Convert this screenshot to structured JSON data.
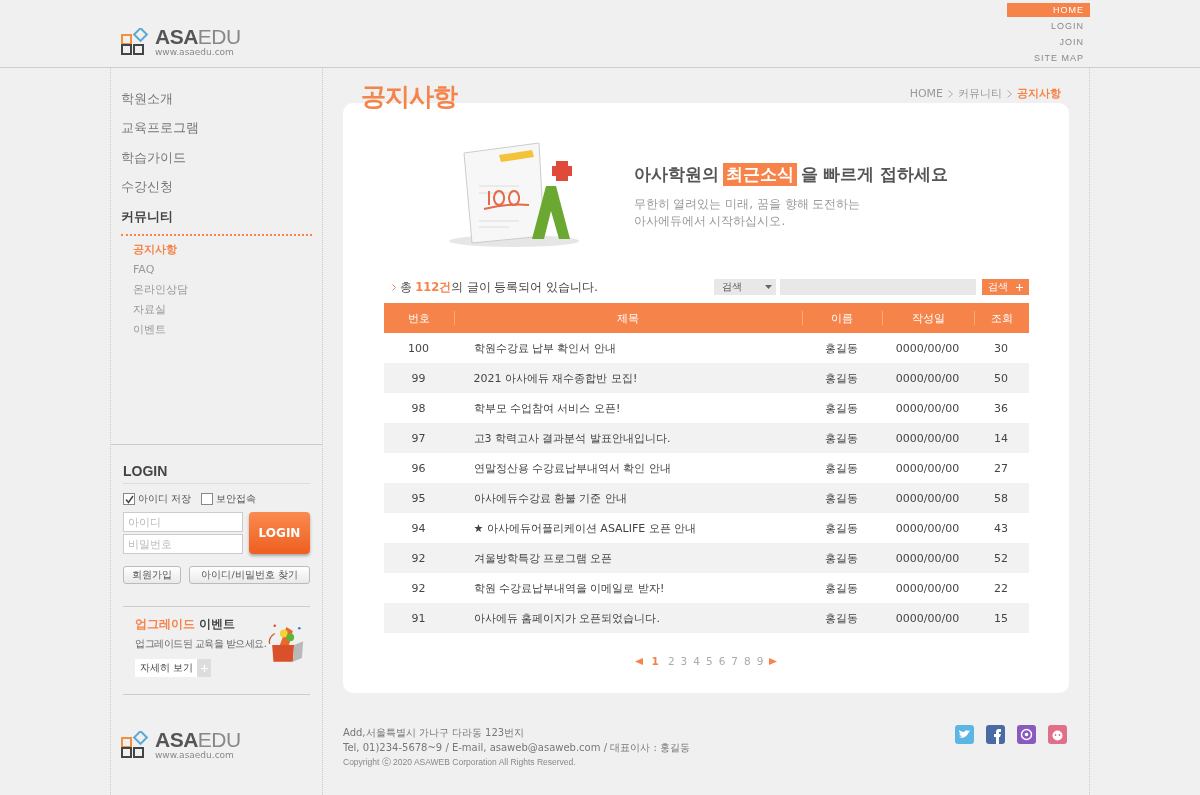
{
  "header": {
    "logo": {
      "name_bold": "ASA",
      "name_light": "EDU",
      "url": "www.asaedu.com"
    },
    "top_links": [
      {
        "label": "HOME",
        "selected": true
      },
      {
        "label": "LOGIN",
        "selected": false
      },
      {
        "label": "JOIN",
        "selected": false
      },
      {
        "label": "SITE MAP",
        "selected": false
      }
    ]
  },
  "sidebar": {
    "menu": [
      {
        "label": "학원소개",
        "expanded": false
      },
      {
        "label": "교육프로그램",
        "expanded": false
      },
      {
        "label": "학습가이드",
        "expanded": false
      },
      {
        "label": "수강신청",
        "expanded": false
      },
      {
        "label": "커뮤니티",
        "expanded": true,
        "children": [
          {
            "label": "공지사항",
            "selected": true
          },
          {
            "label": "FAQ",
            "selected": false
          },
          {
            "label": "온라인상담",
            "selected": false
          },
          {
            "label": "자료실",
            "selected": false
          },
          {
            "label": "이벤트",
            "selected": false
          }
        ]
      }
    ],
    "login": {
      "title": "LOGIN",
      "options": [
        {
          "label": "아이디 저장",
          "checked": true
        },
        {
          "label": "보안접속",
          "checked": false
        }
      ],
      "id_placeholder": "아이디",
      "password_placeholder": "비밀번호",
      "submit": "LOGIN",
      "buttons": [
        "회원가입",
        "아이디/비밀번호 찾기"
      ]
    },
    "event": {
      "title_accent": "업그레이드",
      "title_rest": "이벤트",
      "text": "업그레이드된 교육을 받으세요.",
      "button": "자세히 보기"
    }
  },
  "page_title": "공지사항",
  "breadcrumb": [
    {
      "label": "HOME",
      "selected": false
    },
    {
      "label": "커뮤니티",
      "selected": false
    },
    {
      "label": "공지사항",
      "selected": true
    }
  ],
  "hero": {
    "headline_before": "아사학원의",
    "headline_highlight": "최근소식",
    "headline_after": "을 빠르게 접하세요",
    "subtitle_lines": [
      "무한히 열려있는 미래, 꿈을 향해 도전하는",
      "아사에듀에서 시작하십시오."
    ]
  },
  "count_text": "총 **112건**의 글이 등록되어 있습니다.",
  "search": {
    "select": "검색",
    "button": "검색"
  },
  "table": {
    "columns": [
      "번호",
      "제목",
      "이름",
      "작성일",
      "조회"
    ],
    "rows": [
      [
        "100",
        "학원수강료 납부 확인서 안내",
        "홍길동",
        "0000/00/00",
        "30"
      ],
      [
        "99",
        "2021 아사에듀 재수종합반 모집!",
        "홍길동",
        "0000/00/00",
        "50"
      ],
      [
        "98",
        "학부모 수업참여 서비스 오픈!",
        "홍길동",
        "0000/00/00",
        "36"
      ],
      [
        "97",
        "고3 학력고사 결과분석 발표안내입니다.",
        "홍길동",
        "0000/00/00",
        "14"
      ],
      [
        "96",
        "연말정산용 수강료납부내역서 확인 안내",
        "홍길동",
        "0000/00/00",
        "27"
      ],
      [
        "95",
        "아사에듀수강료 환불 기준 안내",
        "홍길동",
        "0000/00/00",
        "58"
      ],
      [
        "94",
        "★ 아사에듀어플리케이션 ASALIFE 오픈 안내",
        "홍길동",
        "0000/00/00",
        "43"
      ],
      [
        "92",
        "겨울방학특강 프로그램 오픈",
        "홍길동",
        "0000/00/00",
        "52"
      ],
      [
        "92",
        "학원 수강료납부내역을 이메일로 받자!",
        "홍길동",
        "0000/00/00",
        "22"
      ],
      [
        "91",
        "아사에듀 홈페이지가 오픈되었습니다.",
        "홍길동",
        "0000/00/00",
        "15"
      ]
    ]
  },
  "pagination": [
    {
      "label": "1",
      "selected": true
    },
    {
      "label": "2",
      "selected": false
    },
    {
      "label": "3",
      "selected": false
    },
    {
      "label": "4",
      "selected": false
    },
    {
      "label": "5",
      "selected": false
    },
    {
      "label": "6",
      "selected": false
    },
    {
      "label": "7",
      "selected": false
    },
    {
      "label": "8",
      "selected": false
    },
    {
      "label": "9",
      "selected": false
    }
  ],
  "footer": {
    "lines": [
      "Add,서울특별시 가나구 다라동 123번지",
      "Tel, 01)234-5678~9 / E-mail, asaweb@asaweb.com / 대표이사 : 홍길동"
    ],
    "copyright": "Copyright ⓒ 2020 ASAWEB Corporation All Rights Reserved.",
    "logo": {
      "name_bold": "ASA",
      "name_light": "EDU",
      "url": "www.asaedu.com"
    }
  }
}
